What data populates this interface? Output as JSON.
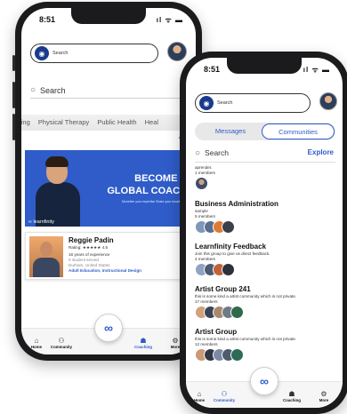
{
  "back_phone": {
    "status_time": "8:51",
    "status_icons": "ıl ᯤ ▬",
    "top_search_label": "Search",
    "search_placeholder": "Search",
    "chips": [
      "ying",
      "Physical Therapy",
      "Public Health",
      "Heal"
    ],
    "banner": {
      "line1": "BECOME A",
      "line2": "GLOBAL COACH",
      "sub": "Monetize your expertise     Share your knowledge",
      "logo": "learnfinity"
    },
    "coach": {
      "name": "Reggie Padin",
      "rating": "Rating: ★★★★★ 4.5",
      "experience": "16 years of experience",
      "served": "0 student served",
      "location": "Durham, United States",
      "tags": "Adult Education, Instructional Design"
    },
    "nav": [
      {
        "label": "Home",
        "icon": "home-icon"
      },
      {
        "label": "Community",
        "icon": "community-icon"
      },
      {
        "label": "Coaching",
        "icon": "coaching-icon"
      },
      {
        "label": "More",
        "icon": "settings-icon"
      }
    ]
  },
  "front_phone": {
    "status_time": "8:51",
    "status_icons": "ıl ᯤ ▬",
    "top_search_label": "Search",
    "tabs": {
      "messages": "Messages",
      "communities": "Communities"
    },
    "search_placeholder": "Search",
    "explore_label": "Explore",
    "communities": [
      {
        "title": "",
        "description": "aprender.",
        "count": "1 members",
        "members": 1
      },
      {
        "title": "Business Administration",
        "description": "sample",
        "count": "5 members",
        "members": 4
      },
      {
        "title": "Learnfinity Feedback",
        "description": "Join this group to give us direct feedback.",
        "count": "4 members",
        "members": 4
      },
      {
        "title": "Artist Group 241",
        "description": "this is some kind a artist community which is not private.",
        "count": "17 members",
        "members": 5
      },
      {
        "title": "Artist Group",
        "description": "this is some kind a artist community which is not private.",
        "count": "12 members",
        "members": 5
      }
    ],
    "nav": [
      {
        "label": "Home",
        "icon": "home-icon"
      },
      {
        "label": "Community",
        "icon": "community-icon"
      },
      {
        "label": "Coaching",
        "icon": "coaching-icon"
      },
      {
        "label": "More",
        "icon": "settings-icon"
      }
    ]
  },
  "colors": {
    "accent": "#2f5cc9",
    "navy": "#1a3a8c",
    "banner": "#2f5cc9"
  }
}
